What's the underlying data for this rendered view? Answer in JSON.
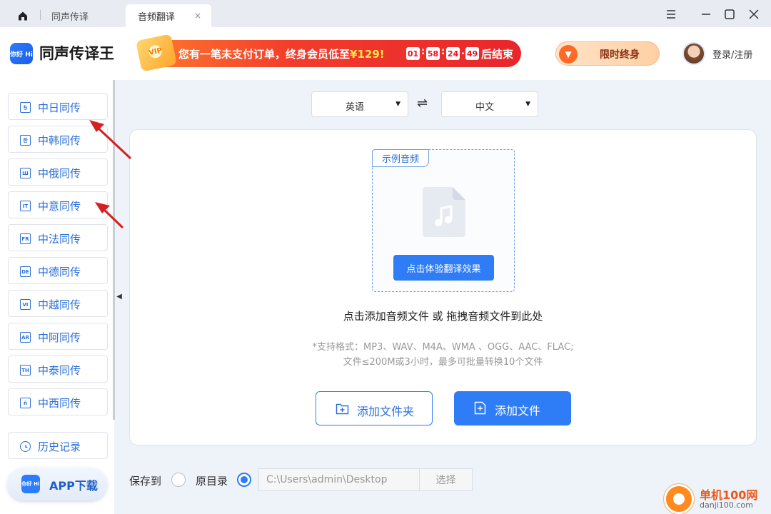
{
  "tabs": {
    "home_icon": "home-icon",
    "tab1": "同声传译",
    "tab2": "音频翻译",
    "tab2_close": "×"
  },
  "window_controls": [
    "menu-icon",
    "minimize-icon",
    "maximize-icon",
    "close-icon"
  ],
  "header": {
    "logo_text": "你好 Hi",
    "app_name": "同声传译王",
    "promo": {
      "badge": "VIP",
      "text_before_price": "您有一笔未支付订单，终身会员低至",
      "price": "¥129!",
      "countdown": [
        "01",
        "58",
        "24",
        "49"
      ],
      "text_after": "后结束"
    },
    "vip_button": "限时终身",
    "login": "登录/注册"
  },
  "sidebar": {
    "items": [
      {
        "icon": "ち",
        "label": "中日同传"
      },
      {
        "icon": "한",
        "label": "中韩同传"
      },
      {
        "icon": "Ш",
        "label": "中俄同传"
      },
      {
        "icon": "IT",
        "label": "中意同传"
      },
      {
        "icon": "FR",
        "label": "中法同传"
      },
      {
        "icon": "DE",
        "label": "中德同传"
      },
      {
        "icon": "VI",
        "label": "中越同传"
      },
      {
        "icon": "AR",
        "label": "中阿同传"
      },
      {
        "icon": "TH",
        "label": "中泰同传"
      },
      {
        "icon": "ñ",
        "label": "中西同传"
      }
    ],
    "history": "历史记录",
    "app_download_logo": "你好 Hi",
    "app_download": "APP下载"
  },
  "language": {
    "source": "英语",
    "target": "中文",
    "swap_symbol": "⇌"
  },
  "main": {
    "demo_tag": "示例音频",
    "demo_button": "点击体验翻译效果",
    "hint": "点击添加音频文件 或 拖拽音频文件到此处",
    "formats_line1": "*支持格式：MP3、WAV、M4A、WMA 、OGG、AAC、FLAC;",
    "formats_line2": "文件≤200M或3小时，最多可批量转换10个文件",
    "add_folder": "添加文件夹",
    "add_file": "添加文件"
  },
  "save": {
    "label": "保存到",
    "original_dir": "原目录",
    "path": "C:\\Users\\admin\\Desktop",
    "choose": "选择"
  },
  "watermark": {
    "site_name": "单机100网",
    "url": "danji100.com"
  },
  "colors": {
    "accent": "#2e7cf6",
    "promo_red": "#e8262b",
    "annotation_arrow": "#d42020"
  }
}
